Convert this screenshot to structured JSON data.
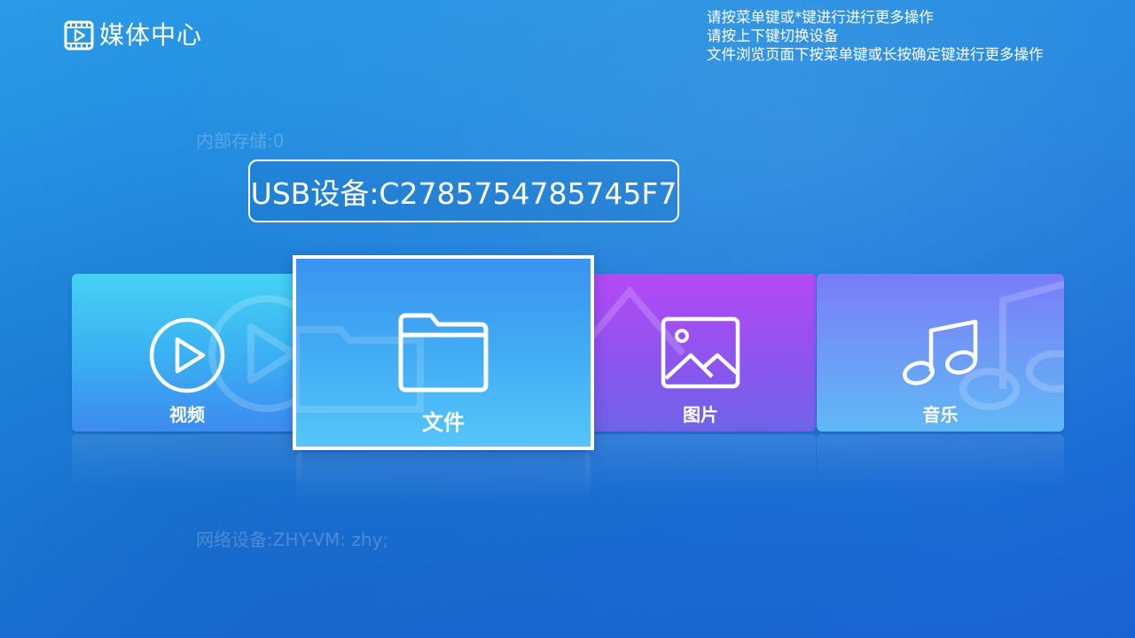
{
  "header": {
    "app_title": "媒体中心",
    "logo_icon": "video-play-icon"
  },
  "hints": [
    "请按菜单键或*键进行进行更多操作",
    "请按上下键切换设备",
    "文件浏览页面下按菜单键或长按确定键进行更多操作"
  ],
  "devices": {
    "internal": "内部存储:0",
    "usb": "USB设备:C2785754785745F7",
    "network": "网络设备:ZHY-VM: zhy;"
  },
  "cards": {
    "video": {
      "label": "视频",
      "icon": "play-circle-icon"
    },
    "files": {
      "label": "文件",
      "icon": "folder-icon"
    },
    "photo": {
      "label": "图片",
      "icon": "image-icon"
    },
    "music": {
      "label": "音乐",
      "icon": "music-note-icon"
    }
  },
  "colors": {
    "background": "#1f86de",
    "video_card": "#3aaef2",
    "files_card": "#43aef4",
    "photo_card": "#8d55ef",
    "music_card": "#6d9ef6",
    "focus_border": "#ffffff"
  }
}
